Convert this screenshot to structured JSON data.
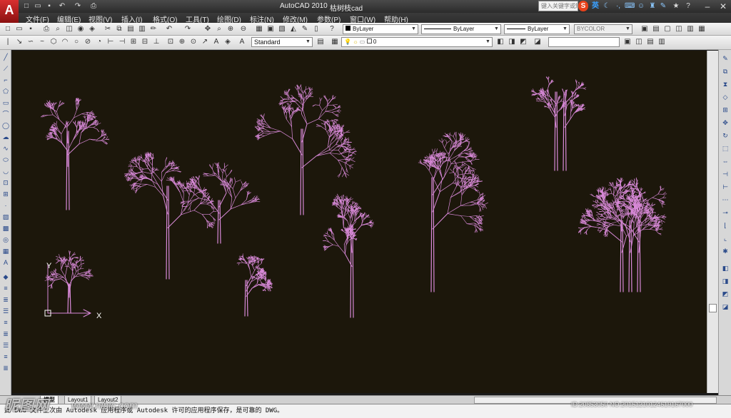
{
  "app": {
    "title": "AutoCAD 2010",
    "file_name": "枯树枝cad",
    "logo_letter": "A",
    "search_placeholder": "键入关键字或短语",
    "ime_labels": [
      "S",
      "英"
    ]
  },
  "menu": [
    "文件(F)",
    "编辑(E)",
    "视图(V)",
    "插入(I)",
    "格式(O)",
    "工具(T)",
    "绘图(D)",
    "标注(N)",
    "修改(M)",
    "参数(P)",
    "窗口(W)",
    "帮助(H)"
  ],
  "properties": {
    "layer_color": "ByLayer",
    "linetype": "ByLayer",
    "lineweight": "ByLayer",
    "plot_style": "BYCOLOR"
  },
  "styles": {
    "text_style": "Standard",
    "current_layer": "0"
  },
  "canvas": {
    "background": "#1c170b",
    "tree_color": "#d98ad9",
    "ucs_x": "X",
    "ucs_y": "Y"
  },
  "tabs": [
    "模型",
    "Layout1",
    "Layout2"
  ],
  "command_line": "此 DWG 文件上次由 Autodesk 应用程序或 Autodesk 许可的应用程序保存，是可靠的 DWG。",
  "watermark": {
    "brand": "昵图网",
    "url": "www.nipic.com",
    "id": "ID:20853050 NO:20151210124619167000"
  }
}
